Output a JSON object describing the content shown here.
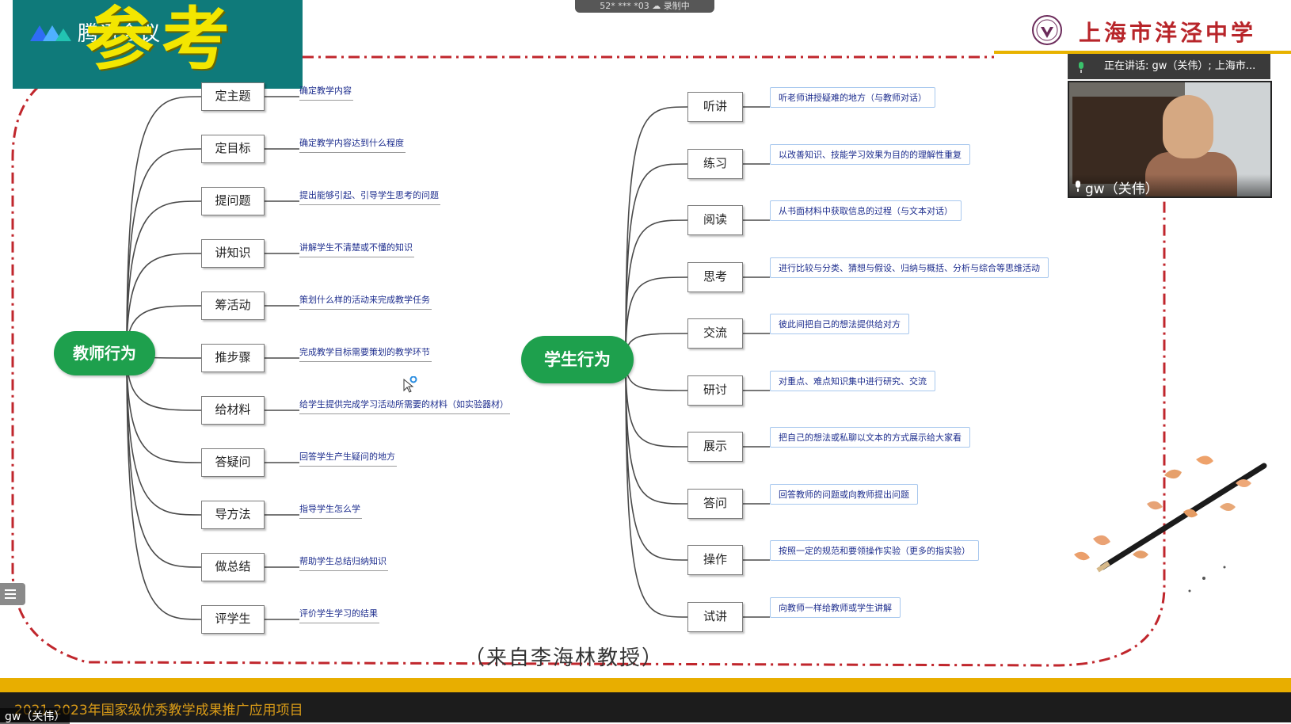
{
  "meeting": {
    "app_name": "腾讯会议",
    "network_label": "52* *** *03  ☁ 录制中",
    "speaking_label": "正在讲话: gw（关伟）; 上海市...",
    "participant_name": "gw（关伟）",
    "self_name": "gw（关伟）"
  },
  "slide": {
    "big_title": "参考",
    "school_name": "上海市洋泾中学",
    "source_note": "（来自李海林教授）",
    "footer_project": "2021-2023年国家级优秀教学成果推广应用项目",
    "teacher": {
      "root": "教师行为",
      "items": [
        {
          "label": "定主题",
          "desc": "确定教学内容"
        },
        {
          "label": "定目标",
          "desc": "确定教学内容达到什么程度"
        },
        {
          "label": "提问题",
          "desc": "提出能够引起、引导学生思考的问题"
        },
        {
          "label": "讲知识",
          "desc": "讲解学生不清楚或不懂的知识"
        },
        {
          "label": "筹活动",
          "desc": "策划什么样的活动来完成教学任务"
        },
        {
          "label": "推步骤",
          "desc": "完成教学目标需要策划的教学环节"
        },
        {
          "label": "给材料",
          "desc": "给学生提供完成学习活动所需要的材料（如实验器材）"
        },
        {
          "label": "答疑问",
          "desc": "回答学生产生疑问的地方"
        },
        {
          "label": "导方法",
          "desc": "指导学生怎么学"
        },
        {
          "label": "做总结",
          "desc": "帮助学生总结归纳知识"
        },
        {
          "label": "评学生",
          "desc": "评价学生学习的结果"
        }
      ]
    },
    "student": {
      "root": "学生行为",
      "items": [
        {
          "label": "听讲",
          "desc": "听老师讲授疑难的地方（与教师对话）"
        },
        {
          "label": "练习",
          "desc": "以改善知识、技能学习效果为目的的理解性重复"
        },
        {
          "label": "阅读",
          "desc": "从书面材料中获取信息的过程（与文本对话）"
        },
        {
          "label": "思考",
          "desc": "进行比较与分类、猜想与假设、归纳与概括、分析与综合等思维活动"
        },
        {
          "label": "交流",
          "desc": "彼此间把自己的想法提供给对方"
        },
        {
          "label": "研讨",
          "desc": "对重点、难点知识集中进行研究、交流"
        },
        {
          "label": "展示",
          "desc": "把自己的想法或私聊以文本的方式展示给大家看"
        },
        {
          "label": "答问",
          "desc": "回答教师的问题或向教师提出问题"
        },
        {
          "label": "操作",
          "desc": "按照一定的规范和要领操作实验（更多的指实验）"
        },
        {
          "label": "试讲",
          "desc": "向教师一样给教师或学生讲解"
        }
      ]
    }
  },
  "colors": {
    "root_green": "#1ea04d",
    "overlay_teal": "#0f7a7a",
    "title_yellow": "#f3e600",
    "frame_red": "#c0262c",
    "school_red": "#b8252a",
    "footer_gold": "#e8ae00"
  }
}
